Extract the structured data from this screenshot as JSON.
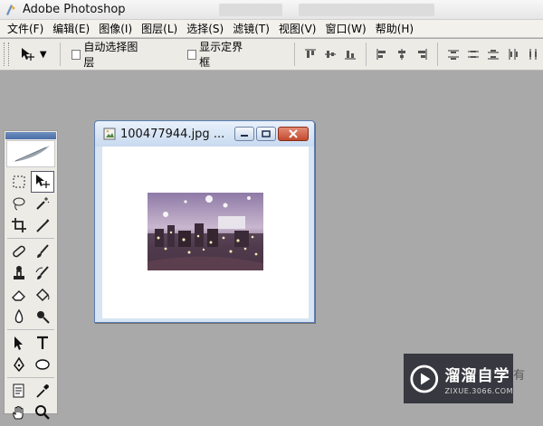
{
  "app": {
    "title": "Adobe Photoshop"
  },
  "menu": [
    "文件(F)",
    "编辑(E)",
    "图像(I)",
    "图层(L)",
    "选择(S)",
    "滤镜(T)",
    "视图(V)",
    "窗口(W)",
    "帮助(H)"
  ],
  "options": {
    "auto_select_label": "自动选择图层",
    "show_bounds_label": "显示定界框",
    "tool_preset_icon": "move-tool-icon"
  },
  "document": {
    "title": "100477944.jpg ..."
  },
  "watermark": {
    "main": "溜溜自学",
    "sub": "ZIXUE.3066.COM",
    "edge": "有"
  },
  "colors": {
    "workspace": "#a9a9a9",
    "doc_frame": "#d7e4f3",
    "close_button": "#c24a2d"
  }
}
